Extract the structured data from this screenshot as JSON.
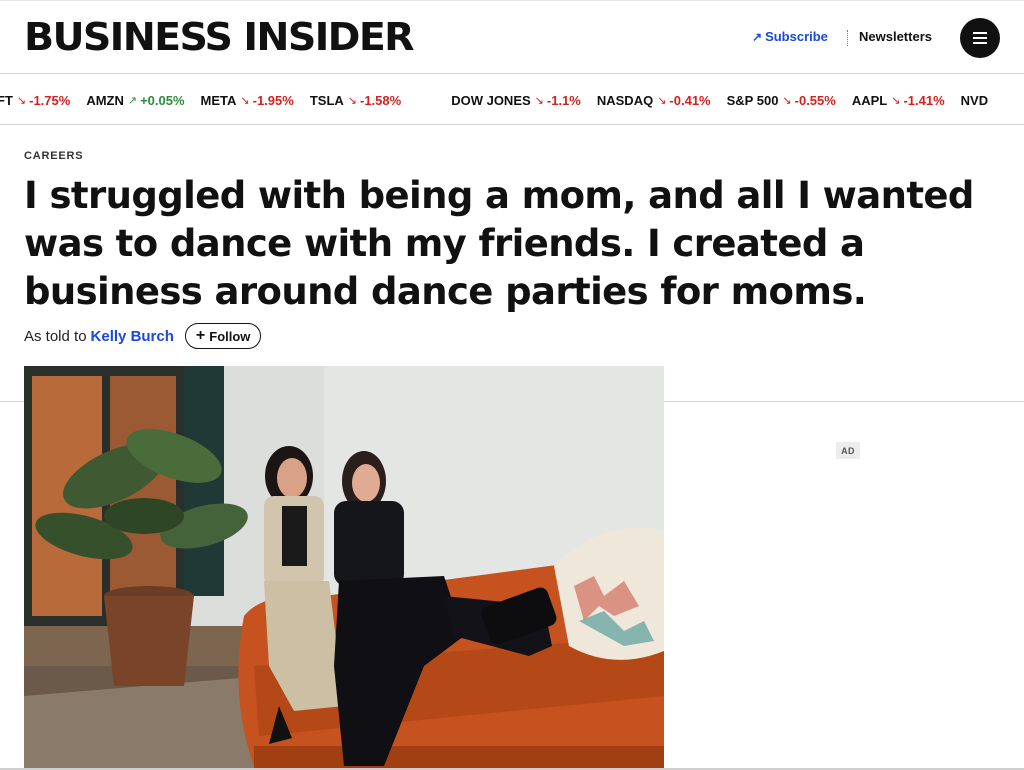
{
  "header": {
    "logo": "BUSINESS INSIDER",
    "subscribe_label": "Subscribe",
    "newsletters_label": "Newsletters",
    "menu_icon": "hamburger-icon"
  },
  "ticker": [
    {
      "symbol": "FT",
      "change": "-1.75%",
      "direction": "down"
    },
    {
      "symbol": "AMZN",
      "change": "+0.05%",
      "direction": "up"
    },
    {
      "symbol": "META",
      "change": "-1.95%",
      "direction": "down"
    },
    {
      "symbol": "TSLA",
      "change": "-1.58%",
      "direction": "down"
    },
    {
      "symbol": "DOW JONES",
      "change": "-1.1%",
      "direction": "down"
    },
    {
      "symbol": "NASDAQ",
      "change": "-0.41%",
      "direction": "down"
    },
    {
      "symbol": "S&P 500",
      "change": "-0.55%",
      "direction": "down"
    },
    {
      "symbol": "AAPL",
      "change": "-1.41%",
      "direction": "down"
    },
    {
      "symbol": "NVD",
      "change": "",
      "direction": "none"
    }
  ],
  "article": {
    "category": "CAREERS",
    "headline": "I struggled with being a mom, and all I wanted was to dance with my friends. I created a business around dance parties for moms.",
    "byline_prefix": "As told to",
    "author": "Kelly Burch",
    "follow_label": "Follow"
  },
  "ad": {
    "label": "AD"
  },
  "colors": {
    "accent_blue": "#1a48e0",
    "down_red": "#d3211f",
    "up_green": "#2d8a3e",
    "sofa_orange": "#c5521f"
  }
}
